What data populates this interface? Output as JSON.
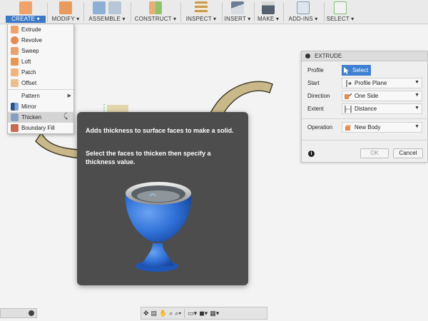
{
  "toolbar": {
    "groups": [
      {
        "label": "CREATE ▾",
        "icon": "create-icon"
      },
      {
        "label": "MODIFY ▾",
        "icon": "modify-icon"
      },
      {
        "label": "ASSEMBLE ▾",
        "icon": "assemble-icon"
      },
      {
        "label": "CONSTRUCT ▾",
        "icon": "construct-icon"
      },
      {
        "label": "INSPECT ▾",
        "icon": "inspect-icon"
      },
      {
        "label": "INSERT ▾",
        "icon": "insert-icon"
      },
      {
        "label": "MAKE ▾",
        "icon": "make-icon"
      },
      {
        "label": "ADD-INS ▾",
        "icon": "add-ins-icon"
      },
      {
        "label": "SELECT ▾",
        "icon": "select-icon"
      }
    ]
  },
  "create_menu": {
    "items": [
      {
        "label": "Extrude",
        "icon": "extrude-icon"
      },
      {
        "label": "Revolve",
        "icon": "revolve-icon"
      },
      {
        "label": "Sweep",
        "icon": "sweep-icon"
      },
      {
        "label": "Loft",
        "icon": "loft-icon"
      },
      {
        "label": "Patch",
        "icon": "patch-icon"
      },
      {
        "label": "Offset",
        "icon": "offset-icon"
      },
      {
        "label": "Pattern"
      },
      {
        "label": "Mirror",
        "icon": "mirror-icon"
      },
      {
        "label": "Thicken",
        "icon": "thicken-icon"
      },
      {
        "label": "Boundary Fill",
        "icon": "boundary-fill-icon"
      }
    ]
  },
  "tooltip": {
    "line1": "Adds thickness to surface faces to make a solid.",
    "line2": "Select the faces to thicken then specify a thickness value."
  },
  "extrude_panel": {
    "title": "EXTRUDE",
    "profile_label": "Profile",
    "profile_button": "Select",
    "start_label": "Start",
    "start_value": "Profile Plane",
    "direction_label": "Direction",
    "direction_value": "One Side",
    "extent_label": "Extent",
    "extent_value": "Distance",
    "operation_label": "Operation",
    "operation_value": "New Body",
    "ok_label": "OK",
    "cancel_label": "Cancel"
  },
  "colors": {
    "accent": "#3d7fd1",
    "tooltip_bg": "#4d4d4d",
    "sketch_fill": "#e4d7ae",
    "model_blue": "#2f6fd6"
  }
}
